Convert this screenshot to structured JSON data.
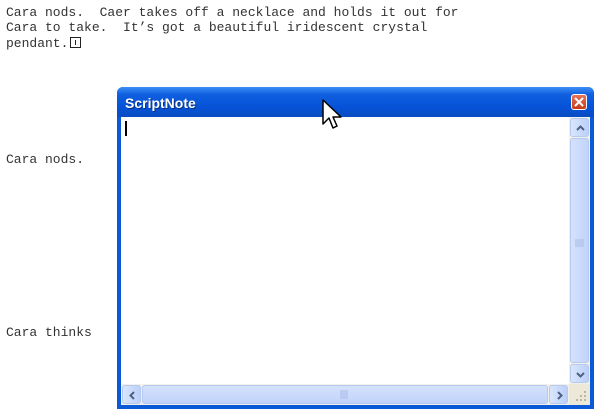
{
  "document": {
    "lines": [
      "Cara nods.  Caer takes off a necklace and holds it out for",
      "Cara to take.  It’s got a beautiful iridescent crystal",
      "pendant."
    ],
    "line2": "Cara nods.",
    "line3": "Cara thinks",
    "note_marker_icon": "note-marker-icon"
  },
  "note_window": {
    "title": "ScriptNote",
    "close_icon": "close-icon",
    "body_text": "",
    "vscroll": {
      "up_icon": "chevron-up-icon",
      "down_icon": "chevron-down-icon"
    },
    "hscroll": {
      "left_icon": "chevron-left-icon",
      "right_icon": "chevron-right-icon"
    },
    "colors": {
      "title_bar": "#0552d6",
      "close_button": "#c63a17",
      "scroll": "#c1d3fa"
    }
  },
  "cursor_icon": "mouse-pointer-icon"
}
